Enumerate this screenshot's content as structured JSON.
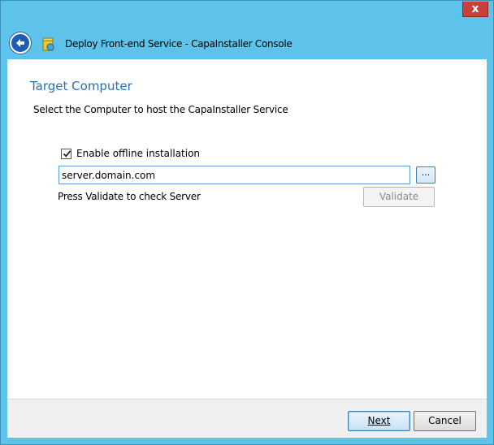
{
  "window": {
    "title": "Deploy Front-end Service - CapaInstaller Console",
    "close_label": "x"
  },
  "page": {
    "title": "Target Computer",
    "subtitle": "Select the Computer to host the CapaInstaller Service"
  },
  "form": {
    "offline_checkbox_label": "Enable offline installation",
    "offline_checked": true,
    "server_value": "server.domain.com",
    "browse_label": "...",
    "hint": "Press Validate to check Server",
    "validate_label": "Validate",
    "validate_enabled": false
  },
  "footer": {
    "next_label": "Next",
    "cancel_label": "Cancel"
  },
  "colors": {
    "frame": "#5ec3ea",
    "accent": "#2a6fb3",
    "close": "#c7423a"
  },
  "icons": {
    "back": "back-arrow-icon",
    "app": "capainstaller-app-icon",
    "checkbox": "checkmark-icon"
  }
}
